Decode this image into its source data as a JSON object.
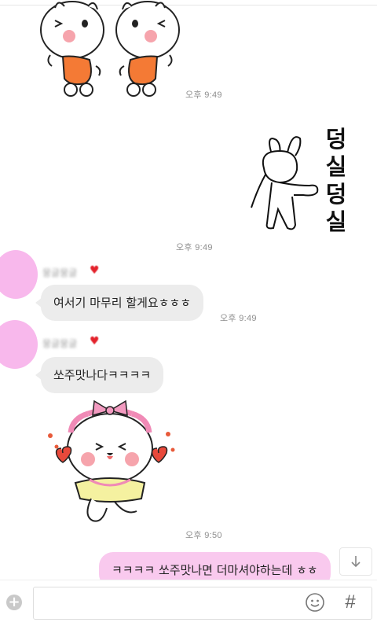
{
  "messages": [
    {
      "type": "sticker",
      "direction": "incoming",
      "sticker": "twin-white-bears-sticker",
      "time": "오후 9:49"
    },
    {
      "type": "sticker",
      "direction": "outgoing",
      "sticker": "bunny-dancing-sticker",
      "text": "덩실덩실",
      "time": "오후 9:49"
    },
    {
      "type": "text",
      "direction": "incoming",
      "sender": "뭉글뭉글",
      "heart": "♥",
      "text": "여서기 마무리 할게요ㅎㅎㅎ",
      "time": "오후 9:49"
    },
    {
      "type": "text",
      "direction": "incoming",
      "sender": "뭉글뭉글",
      "heart": "♥",
      "text": "쏘주맛나다ㅋㅋㅋㅋ"
    },
    {
      "type": "sticker",
      "direction": "incoming",
      "sticker": "cheering-bear-hearts-sticker",
      "time": "오후 9:50"
    },
    {
      "type": "text",
      "direction": "outgoing",
      "text": "ㅋㅋㅋㅋ 쏘주맛나면 더마셔야하는데 ㅎㅎ"
    }
  ],
  "composer": {
    "placeholder": "",
    "hash_label": "#"
  },
  "colors": {
    "incoming_bubble": "#ececec",
    "outgoing_bubble": "#f9c9ee",
    "avatar": "#f8b8ec"
  },
  "icons": {
    "plus": "plus-circle-icon",
    "emoji": "smiley-icon",
    "scroll": "arrow-down-icon"
  }
}
